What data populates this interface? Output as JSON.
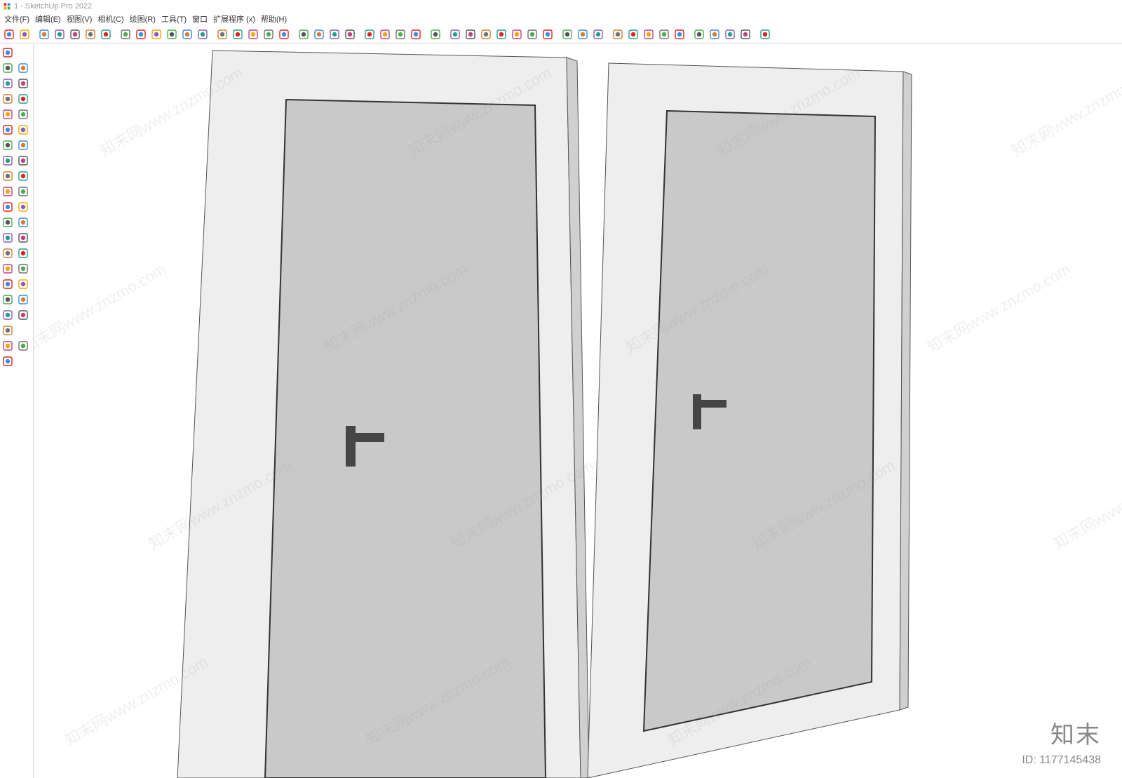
{
  "app": {
    "doc_title": "1 - SketchUp Pro 2022"
  },
  "menus": [
    {
      "label": "文件(F)"
    },
    {
      "label": "编辑(E)"
    },
    {
      "label": "视图(V)"
    },
    {
      "label": "相机(C)"
    },
    {
      "label": "绘图(R)"
    },
    {
      "label": "工具(T)"
    },
    {
      "label": "窗口"
    },
    {
      "label": "扩展程序 (x)"
    },
    {
      "label": "帮助(H)"
    }
  ],
  "toolbar_top": [
    {
      "name": "zoom-icon"
    },
    {
      "name": "select-icon"
    },
    {
      "sep": true
    },
    {
      "name": "eraser-icon"
    },
    {
      "name": "pencil-icon"
    },
    {
      "name": "arc-icon"
    },
    {
      "name": "freehand-icon"
    },
    {
      "name": "rect-icon"
    },
    {
      "sep": true
    },
    {
      "name": "pushpull-icon"
    },
    {
      "name": "move-icon"
    },
    {
      "name": "rotate-icon"
    },
    {
      "name": "scale-icon"
    },
    {
      "name": "offset-icon"
    },
    {
      "name": "followme-icon"
    },
    {
      "sep": true
    },
    {
      "name": "tape-icon"
    },
    {
      "name": "text-icon"
    },
    {
      "name": "dimension-icon"
    },
    {
      "name": "paint-icon"
    },
    {
      "name": "axes-icon"
    },
    {
      "sep": true
    },
    {
      "name": "orbit-icon"
    },
    {
      "name": "pan-icon"
    },
    {
      "name": "zoom2-icon"
    },
    {
      "name": "zoomext-icon"
    },
    {
      "sep": true
    },
    {
      "name": "plugin1-icon"
    },
    {
      "name": "plugin2-icon"
    },
    {
      "name": "plugin3-icon"
    },
    {
      "name": "plugin4-icon"
    },
    {
      "sep": true
    },
    {
      "name": "user-icon"
    },
    {
      "sep": true
    },
    {
      "name": "iso-icon"
    },
    {
      "name": "front-icon"
    },
    {
      "name": "top-icon"
    },
    {
      "name": "right-icon"
    },
    {
      "name": "back-icon"
    },
    {
      "name": "left-icon"
    },
    {
      "name": "bottom-icon"
    },
    {
      "sep": true
    },
    {
      "name": "tag-icon"
    },
    {
      "name": "outliner-icon"
    },
    {
      "name": "camera-icon"
    },
    {
      "sep": true
    },
    {
      "name": "add-icon"
    },
    {
      "name": "warehouse-icon"
    },
    {
      "name": "wh2-icon"
    },
    {
      "name": "wh3-icon"
    },
    {
      "name": "cloud-icon"
    },
    {
      "sep": true
    },
    {
      "name": "settings-icon"
    },
    {
      "name": "panel-icon"
    },
    {
      "name": "info-icon"
    },
    {
      "name": "cart-icon"
    },
    {
      "sep": true
    },
    {
      "name": "profile-icon"
    }
  ],
  "toolbar_left": [
    [
      "select2-icon",
      null
    ],
    [
      "paint2-icon",
      "eraser2-icon"
    ],
    [
      "line-icon",
      "arc2-icon"
    ],
    [
      "freehand2-icon",
      "freehand3-icon"
    ],
    [
      "rect2-icon",
      "rect3-icon"
    ],
    [
      "circle-icon",
      "polygon-icon"
    ],
    [
      "arc3-icon",
      "pie-icon"
    ],
    [
      "move2-icon",
      "pushpull2-icon"
    ],
    [
      "rotate2-icon",
      "followme2-icon"
    ],
    [
      "scale2-icon",
      "offset2-icon"
    ],
    [
      "tape2-icon",
      "protractor-icon"
    ],
    [
      "text2-icon",
      "dim-icon"
    ],
    [
      "axes2-icon",
      "section-icon"
    ],
    [
      "walk-icon",
      "look-icon"
    ],
    [
      "orbit2-icon",
      "pan2-icon"
    ],
    [
      "zoom3-icon",
      "zoomwin-icon"
    ],
    [
      "zoomext2-icon",
      "prev-icon"
    ],
    [
      "position-icon",
      "look2-icon"
    ],
    [
      "walk2-icon",
      null
    ],
    [
      "plugin5-icon",
      "plugin6-icon"
    ],
    [
      "plugin7-icon",
      null
    ]
  ],
  "watermark": {
    "logo": "知末",
    "id_label": "ID: 1177145438",
    "diag": "知末网www.znzmo.com"
  }
}
